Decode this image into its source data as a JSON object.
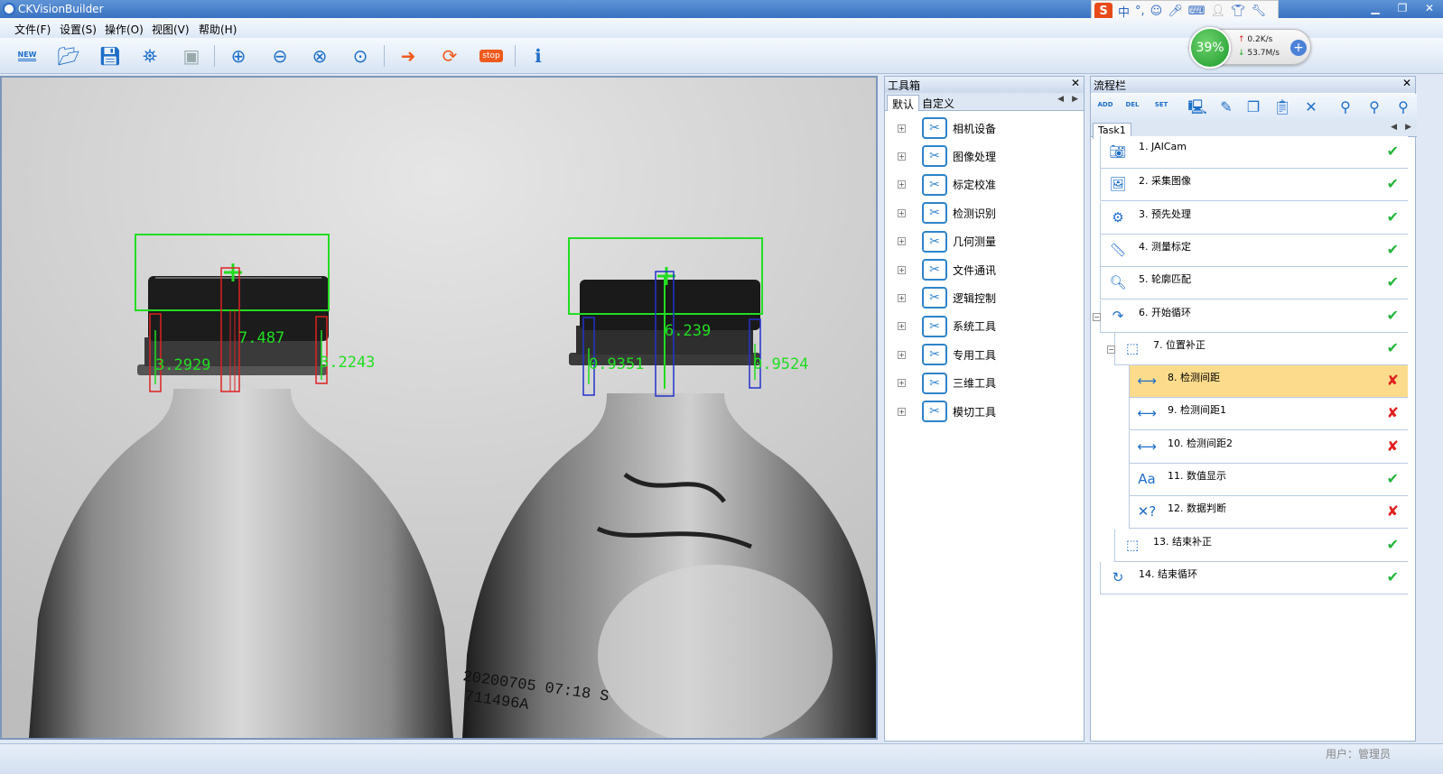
{
  "window": {
    "title": "CKVisionBuilder"
  },
  "ime": {
    "logo": "S",
    "mode": "中",
    "punct": "°,"
  },
  "menu": [
    "文件(F)",
    "设置(S)",
    "操作(O)",
    "视图(V)",
    "帮助(H)"
  ],
  "toolbar": {
    "new_label": "NEW",
    "stop_label": "stop"
  },
  "network": {
    "percent": "39%",
    "up": "0.2K/s",
    "down": "53.7M/s"
  },
  "viewer": {
    "measurements": [
      "7.487",
      "3.2929",
      "3.2243",
      "6.239",
      "0.9351",
      "0.9524"
    ],
    "print_line1": "20200705 07:18 S",
    "print_line2": "711496A"
  },
  "toolbox": {
    "title": "工具箱",
    "tabs": [
      "默认",
      "自定义"
    ],
    "items": [
      "相机设备",
      "图像处理",
      "标定校准",
      "检测识别",
      "几何测量",
      "文件通讯",
      "逻辑控制",
      "系统工具",
      "专用工具",
      "三维工具",
      "模切工具"
    ]
  },
  "flow": {
    "title": "流程栏",
    "tool_labels": [
      "ADD",
      "DEL",
      "SET"
    ],
    "task_tab": "Task1",
    "steps": [
      {
        "label": "1. JAICam",
        "status": "ok"
      },
      {
        "label": "2. 采集图像",
        "status": "ok"
      },
      {
        "label": "3. 预先处理",
        "status": "ok"
      },
      {
        "label": "4. 测量标定",
        "status": "ok"
      },
      {
        "label": "5. 轮廓匹配",
        "status": "ok"
      },
      {
        "label": "6. 开始循环",
        "status": "ok"
      },
      {
        "label": "7. 位置补正",
        "status": "ok"
      },
      {
        "label": "8. 检测间距",
        "status": "error",
        "selected": true
      },
      {
        "label": "9. 检测间距1",
        "status": "error"
      },
      {
        "label": "10. 检测间距2",
        "status": "error"
      },
      {
        "label": "11. 数值显示",
        "status": "ok"
      },
      {
        "label": "12. 数据判断",
        "status": "error"
      },
      {
        "label": "13. 结束补正",
        "status": "ok"
      },
      {
        "label": "14. 结束循环",
        "status": "ok"
      }
    ]
  },
  "status": {
    "user": "用户：管理员"
  }
}
